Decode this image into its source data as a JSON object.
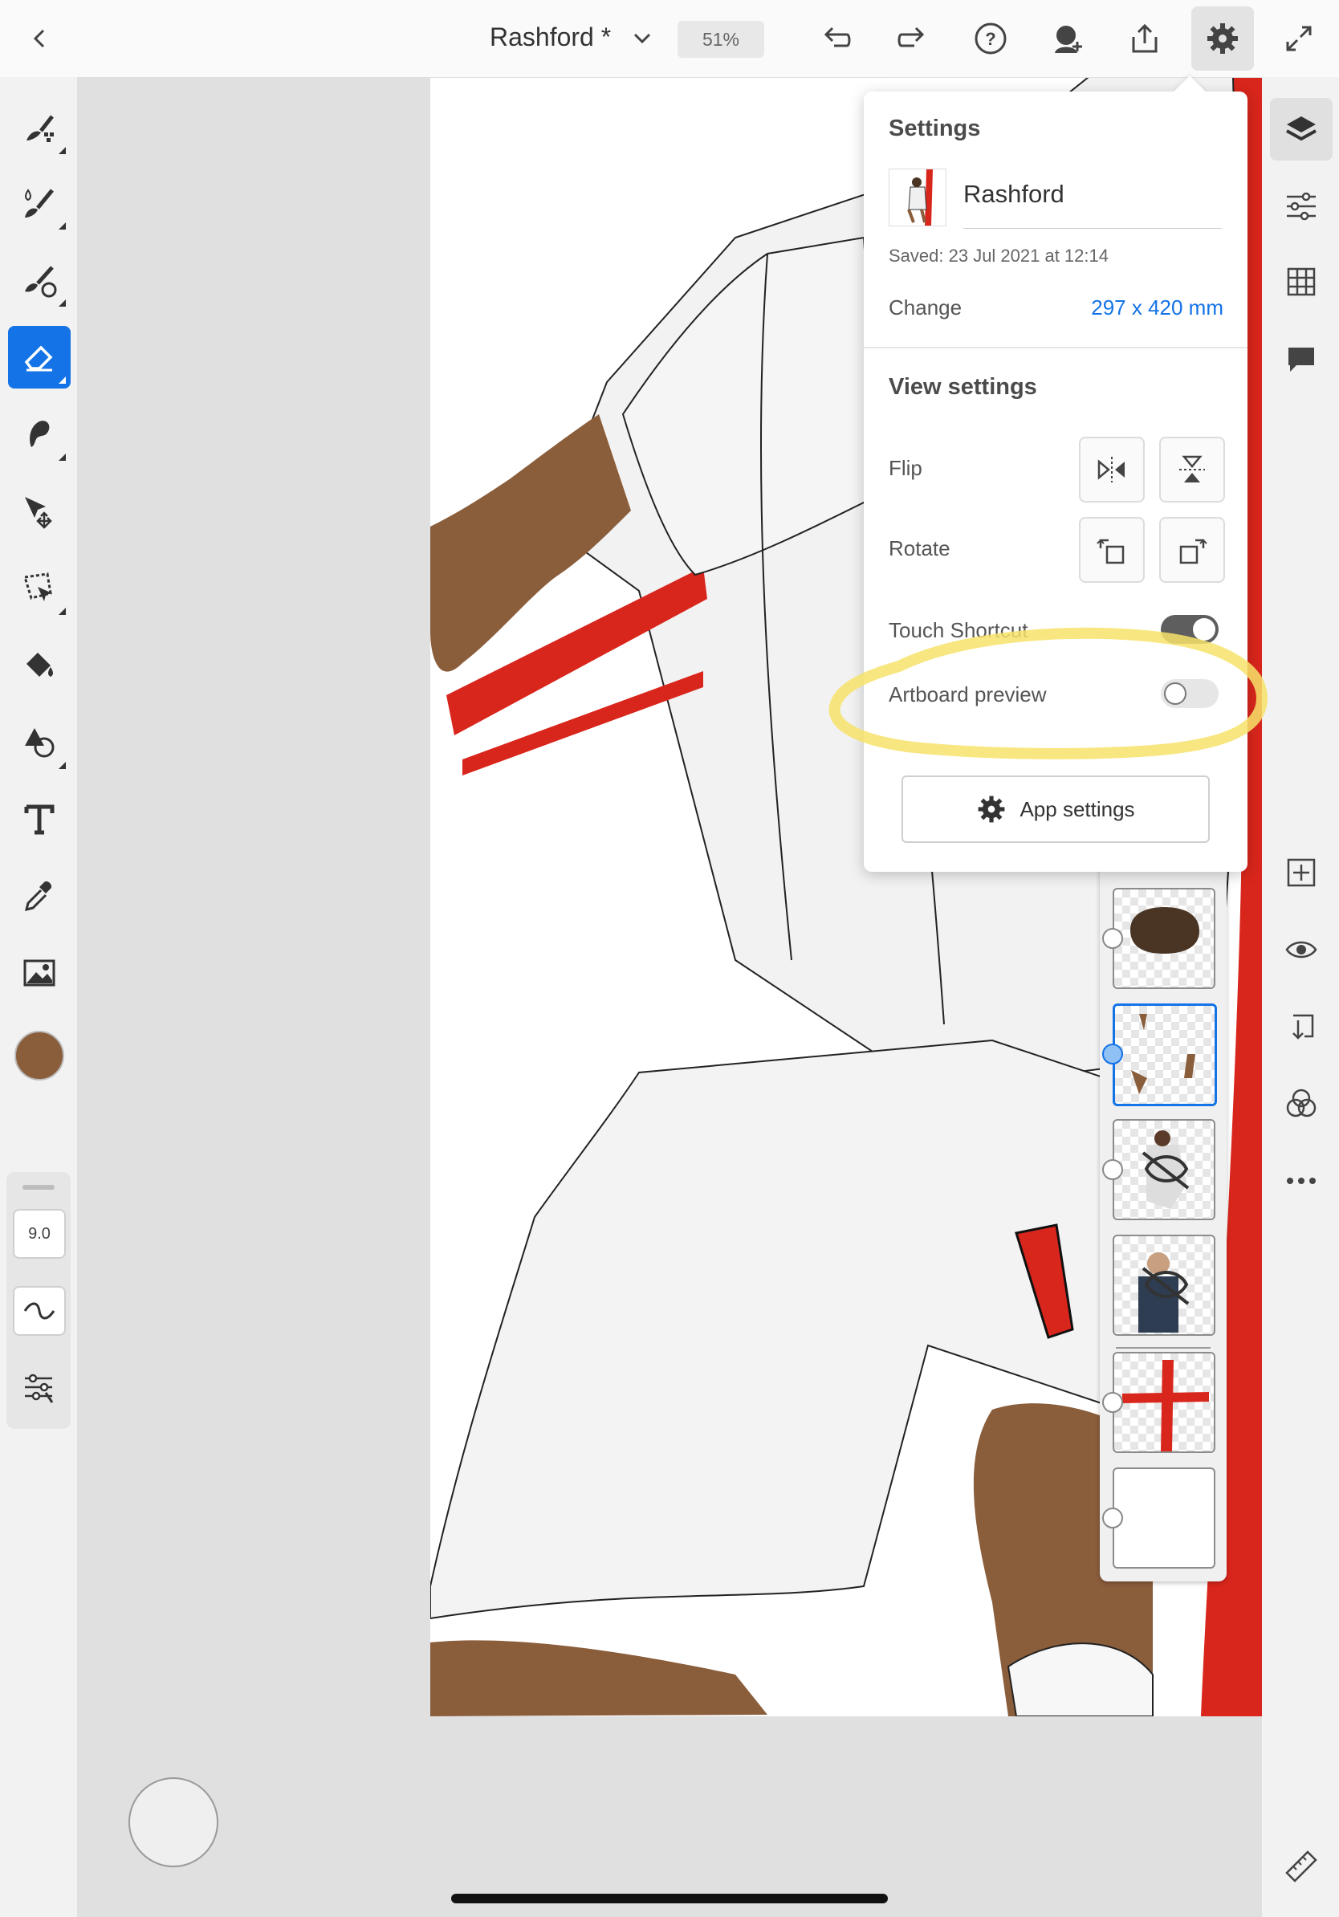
{
  "topbar": {
    "back_icon": "chevron-left-icon",
    "title": "Rashford *",
    "zoom": "51%",
    "icons": [
      "chevron-down-icon",
      "undo-icon",
      "redo-icon",
      "help-icon",
      "invite-icon",
      "share-icon",
      "gear-icon",
      "fullscreen-icon"
    ]
  },
  "left_toolbar": {
    "tools": [
      "pixel-brush-icon",
      "live-brush-icon",
      "vector-brush-icon",
      "eraser-icon",
      "smudge-icon",
      "transform-icon",
      "lasso-icon",
      "fill-icon",
      "shape-icon",
      "text-icon",
      "eyedropper-icon",
      "image-icon"
    ],
    "active_tool": "eraser-icon",
    "color": "#8a5d3b",
    "brush_size": "9.0"
  },
  "right_toolbar": {
    "icons": [
      "layers-icon",
      "layer-properties-icon",
      "grid-icon",
      "comment-icon",
      "add-layer-icon",
      "visibility-icon",
      "merge-icon",
      "blend-icon",
      "more-icon",
      "ruler-icon"
    ]
  },
  "settings": {
    "header": "Settings",
    "doc_name": "Rashford",
    "saved": "Saved: 23 Jul 2021 at 12:14",
    "change_label": "Change",
    "doc_size": "297 x 420 mm",
    "view_header": "View settings",
    "flip_label": "Flip",
    "rotate_label": "Rotate",
    "touch_shortcut_label": "Touch Shortcut",
    "touch_shortcut_on": true,
    "artboard_preview_label": "Artboard preview",
    "artboard_preview_on": false,
    "app_settings_label": "App settings"
  },
  "colors": {
    "accent": "#1473e6",
    "skin": "#8a5d3b",
    "red": "#d9261c",
    "highlight": "#f7e36a"
  }
}
